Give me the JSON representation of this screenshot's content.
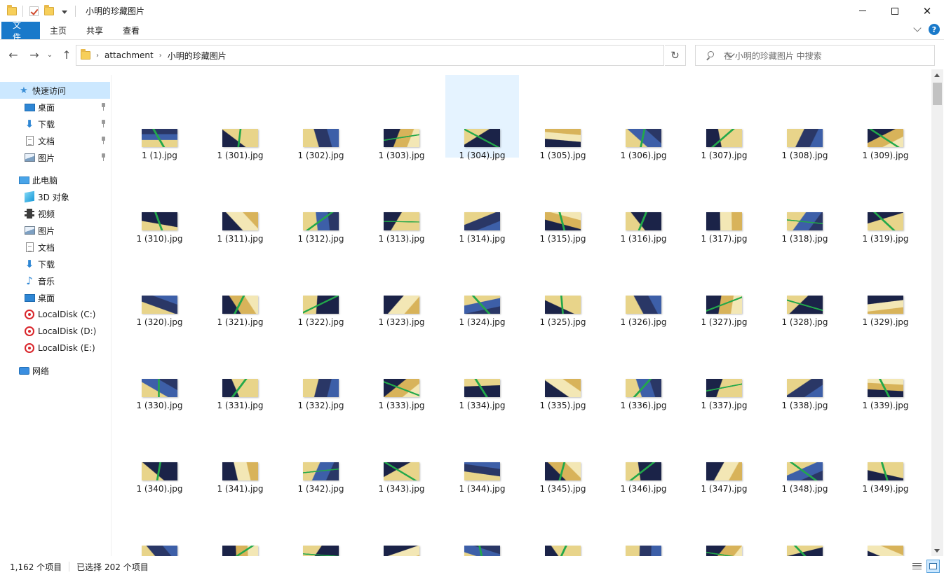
{
  "window": {
    "title": "小明的珍藏图片",
    "controls": {
      "minimize": "min-icon",
      "maximize": "max-icon",
      "close": "✕"
    }
  },
  "ribbon": {
    "tabs": [
      {
        "label": "文件"
      },
      {
        "label": "主页"
      },
      {
        "label": "共享"
      },
      {
        "label": "查看"
      }
    ],
    "help": "?"
  },
  "address": {
    "breadcrumb": [
      "attachment",
      "小明的珍藏图片"
    ],
    "search_placeholder": "在 小明的珍藏图片 中搜索"
  },
  "nav": {
    "quick_access": "快速访问",
    "pinned": [
      {
        "label": "桌面",
        "icon": "desktop-icon"
      },
      {
        "label": "下载",
        "icon": "download-icon"
      },
      {
        "label": "文档",
        "icon": "document-icon"
      },
      {
        "label": "图片",
        "icon": "pictures-icon"
      }
    ],
    "this_pc": "此电脑",
    "pc_items": [
      {
        "label": "3D 对象",
        "icon": "3d-objects-icon"
      },
      {
        "label": "视频",
        "icon": "video-icon"
      },
      {
        "label": "图片",
        "icon": "pictures-icon"
      },
      {
        "label": "文档",
        "icon": "document-icon"
      },
      {
        "label": "下载",
        "icon": "download-icon"
      },
      {
        "label": "音乐",
        "icon": "music-icon"
      },
      {
        "label": "桌面",
        "icon": "desktop-icon"
      },
      {
        "label": "LocalDisk (C:)",
        "icon": "disk-icon"
      },
      {
        "label": "LocalDisk (D:)",
        "icon": "disk-icon"
      },
      {
        "label": "LocalDisk (E:)",
        "icon": "disk-icon"
      }
    ],
    "network": "网络"
  },
  "files": [
    "1 (1).jpg",
    "1 (301).jpg",
    "1 (302).jpg",
    "1 (303).jpg",
    "1 (304).jpg",
    "1 (305).jpg",
    "1 (306).jpg",
    "1 (307).jpg",
    "1 (308).jpg",
    "1 (309).jpg",
    "1 (310).jpg",
    "1 (311).jpg",
    "1 (312).jpg",
    "1 (313).jpg",
    "1 (314).jpg",
    "1 (315).jpg",
    "1 (316).jpg",
    "1 (317).jpg",
    "1 (318).jpg",
    "1 (319).jpg",
    "1 (320).jpg",
    "1 (321).jpg",
    "1 (322).jpg",
    "1 (323).jpg",
    "1 (324).jpg",
    "1 (325).jpg",
    "1 (326).jpg",
    "1 (327).jpg",
    "1 (328).jpg",
    "1 (329).jpg",
    "1 (330).jpg",
    "1 (331).jpg",
    "1 (332).jpg",
    "1 (333).jpg",
    "1 (334).jpg",
    "1 (335).jpg",
    "1 (336).jpg",
    "1 (337).jpg",
    "1 (338).jpg",
    "1 (339).jpg",
    "1 (340).jpg",
    "1 (341).jpg",
    "1 (342).jpg",
    "1 (343).jpg",
    "1 (344).jpg",
    "1 (345).jpg",
    "1 (346).jpg",
    "1 (347).jpg",
    "1 (348).jpg",
    "1 (349).jpg",
    "",
    "",
    "",
    "",
    "",
    "",
    "",
    "",
    "",
    ""
  ],
  "hovered_file": "1 (304).jpg",
  "thumb_palette": [
    "#2a3766",
    "#e8d48a",
    "#3d5fa8",
    "#f3e7b5",
    "#1b2348",
    "#d8b35a",
    "#6f88c4",
    "#ffffff",
    "#22a84a"
  ],
  "status": {
    "item_count": "1,162 个项目",
    "selection": "已选择 202 个项目"
  },
  "colors": {
    "accent": "#1979ca",
    "hover": "#e5f3ff",
    "selected_nav": "#cce8ff"
  }
}
